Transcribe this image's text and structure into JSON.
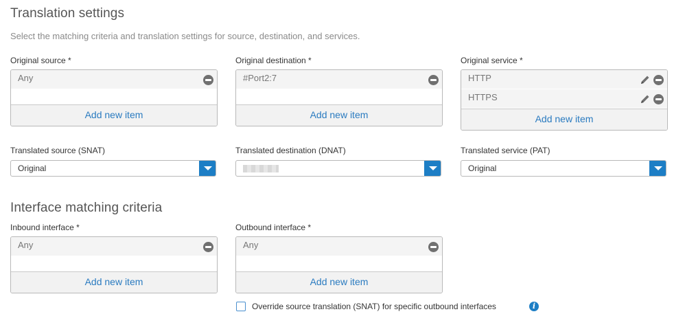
{
  "translation": {
    "title": "Translation settings",
    "description": "Select the matching criteria and translation settings for source, destination, and services.",
    "original_source": {
      "label": "Original source *",
      "items": [
        "Any"
      ],
      "add_label": "Add new item"
    },
    "original_destination": {
      "label": "Original destination *",
      "items": [
        "#Port2:7"
      ],
      "add_label": "Add new item"
    },
    "original_service": {
      "label": "Original service *",
      "items": [
        "HTTP",
        "HTTPS"
      ],
      "add_label": "Add new item"
    },
    "translated_source": {
      "label": "Translated source (SNAT)",
      "value": "Original"
    },
    "translated_destination": {
      "label": "Translated destination (DNAT)",
      "value": ""
    },
    "translated_service": {
      "label": "Translated service (PAT)",
      "value": "Original"
    }
  },
  "interface": {
    "title": "Interface matching criteria",
    "inbound": {
      "label": "Inbound interface *",
      "items": [
        "Any"
      ],
      "add_label": "Add new item"
    },
    "outbound": {
      "label": "Outbound interface *",
      "items": [
        "Any"
      ],
      "add_label": "Add new item"
    },
    "override_checkbox": {
      "label": "Override source translation (SNAT) for specific outbound interfaces",
      "checked": false
    }
  },
  "colors": {
    "accent": "#1d7ec5",
    "link": "#2a7bc0",
    "remove_icon": "#707070"
  },
  "icons": {
    "remove": "minus-circle-icon",
    "edit": "pencil-icon",
    "dropdown": "chevron-down-icon",
    "info": "info-icon"
  }
}
